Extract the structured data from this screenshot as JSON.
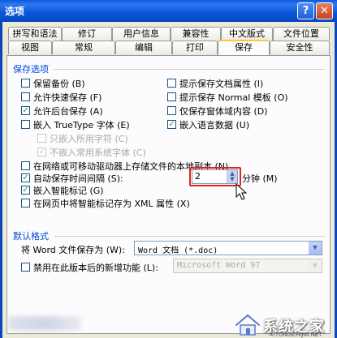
{
  "window": {
    "title": "选项",
    "help": "?",
    "close": "✕"
  },
  "tabs_row1": [
    "拼写和语法",
    "修订",
    "用户信息",
    "兼容性",
    "中文版式",
    "文件位置"
  ],
  "tabs_row2": [
    "视图",
    "常规",
    "编辑",
    "打印",
    "保存",
    "安全性"
  ],
  "active_tab": "保存",
  "save_options": {
    "title": "保存选项",
    "left": [
      {
        "label": "保留备份 (B)",
        "checked": false
      },
      {
        "label": "允许快速保存 (F)",
        "checked": false
      },
      {
        "label": "允许后台保存 (A)",
        "checked": true
      },
      {
        "label": "嵌入 TrueType 字体 (E)",
        "checked": false
      },
      {
        "label": "只嵌入所用字符 (C)",
        "checked": false,
        "disabled": true
      },
      {
        "label": "不嵌入常用系统字体 (C)",
        "checked": true,
        "disabled": true
      }
    ],
    "right": [
      {
        "label": "提示保存文档属性 (I)",
        "checked": false
      },
      {
        "label": "提示保存 Normal 模板 (O)",
        "checked": false
      },
      {
        "label": "仅保存窗体域内容 (D)",
        "checked": false
      },
      {
        "label": "嵌入语言数据 (U)",
        "checked": true
      }
    ],
    "network_copy": {
      "label": "在网络或可移动驱动器上存储文件的本地副本 (N)",
      "checked": false
    },
    "autosave": {
      "label": "自动保存时间间隔 (S):",
      "checked": true,
      "value": "2",
      "unit": "分钟 (M)"
    },
    "smart_tags": {
      "label": "嵌入智能标记 (G)",
      "checked": true
    },
    "xml_props": {
      "label": "在网页中将智能标记存为 XML 属性 (X)",
      "checked": false
    }
  },
  "default_format": {
    "title": "默认格式",
    "save_as_label": "将 Word 文件保存为 (W):",
    "save_as_value": "Word 文档 (*.doc)",
    "disable_label": "禁用在此版本后的新增功能 (L):",
    "disable_checked": false,
    "disable_value": "Microsoft Word 97"
  },
  "watermark": {
    "text": "系统之家",
    "url": "XITONGZHIJIA.NET"
  }
}
